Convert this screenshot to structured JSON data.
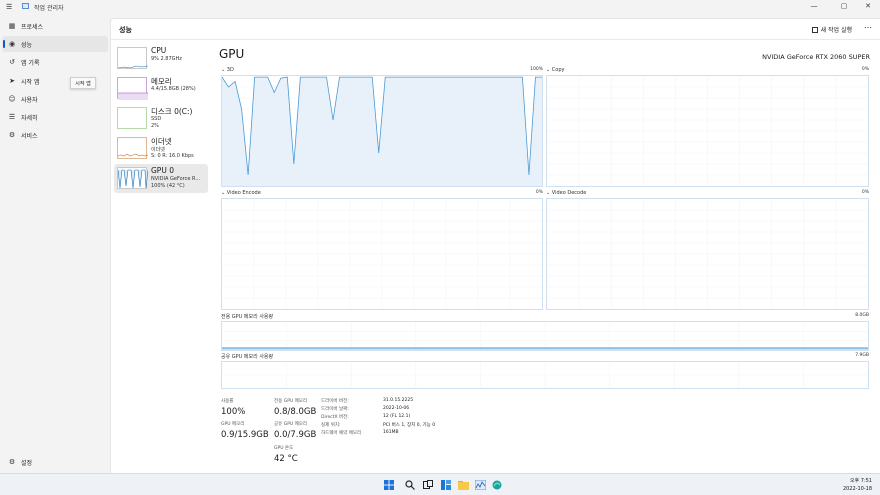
{
  "window": {
    "title": "작업 관리자",
    "minimize": "—",
    "maximize": "▢",
    "close": "✕"
  },
  "nav": {
    "items": [
      {
        "icon": "▦",
        "label": "프로세스"
      },
      {
        "icon": "◉",
        "label": "성능"
      },
      {
        "icon": "↺",
        "label": "앱 기록"
      },
      {
        "icon": "➤",
        "label": "시작 앱"
      },
      {
        "icon": "☺",
        "label": "사용자"
      },
      {
        "icon": "☰",
        "label": "자세히"
      },
      {
        "icon": "⚙",
        "label": "서비스"
      }
    ],
    "settings": {
      "icon": "⚙",
      "label": "설정"
    },
    "tooltip": "시작 앱"
  },
  "header": {
    "title": "성능",
    "run_task": "새 작업 실행",
    "more": "⋯"
  },
  "resources": [
    {
      "name": "CPU",
      "sub1": "9% 2.87GHz",
      "sub2": ""
    },
    {
      "name": "메모리",
      "sub1": "4.4/15.8GB (28%)",
      "sub2": ""
    },
    {
      "name": "디스크 0(C:)",
      "sub1": "SSD",
      "sub2": "2%"
    },
    {
      "name": "이더넷",
      "sub1": "이더넷",
      "sub2": "S: 0 R: 16.0 Kbps"
    },
    {
      "name": "GPU 0",
      "sub1": "NVIDIA GeForce R...",
      "sub2": "100% (42 °C)"
    }
  ],
  "gpu": {
    "title": "GPU",
    "model": "NVIDIA GeForce RTX 2060 SUPER",
    "engines": [
      {
        "label": "3D",
        "pct": "100%"
      },
      {
        "label": "Copy",
        "pct": "0%"
      },
      {
        "label": "Video Encode",
        "pct": "0%"
      },
      {
        "label": "Video Decode",
        "pct": "0%"
      }
    ],
    "dedicated_graph": {
      "label": "전용 GPU 메모리 사용량",
      "max": "8.0GB"
    },
    "shared_graph": {
      "label": "공유 GPU 메모리 사용량",
      "max": "7.9GB"
    },
    "utilization_3d": [
      0.99,
      0.9,
      0.95,
      0.7,
      0.1,
      0.99,
      0.99,
      0.99,
      0.85,
      0.98,
      0.99,
      0.2,
      0.99,
      0.99,
      0.99,
      0.99,
      0.99,
      0.6,
      0.99,
      0.99,
      0.99,
      0.99,
      0.99,
      0.99,
      0.3,
      0.99,
      0.99,
      0.99,
      0.99,
      0.99,
      0.99,
      0.99,
      0.99,
      0.99,
      0.99,
      0.99,
      0.99,
      0.99,
      0.99,
      0.99,
      0.99,
      0.99,
      0.99,
      0.99,
      0.99,
      0.99,
      0.99,
      0.1,
      0.99,
      0.99
    ],
    "stats": [
      {
        "label": "사용률",
        "value": "100%"
      },
      {
        "label": "GPU 메모리",
        "value": "0.9/15.9GB"
      },
      {
        "label": "전용 GPU 메모리",
        "value": "0.8/8.0GB"
      },
      {
        "label": "공유 GPU 메모리",
        "value": "0.0/7.9GB"
      },
      {
        "label": "GPU 온도",
        "value": "42 °C"
      }
    ],
    "info": [
      {
        "label": "드라이버 버전:",
        "value": "31.0.15.2225"
      },
      {
        "label": "드라이버 날짜:",
        "value": "2022-10-06"
      },
      {
        "label": "DirectX 버전:",
        "value": "12 (FL 12.1)"
      },
      {
        "label": "실제 위치:",
        "value": "PCI 버스 1, 장치 0, 기능 0"
      },
      {
        "label": "하드웨어 예약 메모리",
        "value": "161MB"
      }
    ]
  },
  "taskbar": {
    "time": "오후 7:51",
    "date": "2022-10-18",
    "icons": [
      "windows-start-icon",
      "search-icon",
      "task-view-icon",
      "widgets-icon",
      "file-explorer-icon",
      "store-icon",
      "task-manager-icon",
      "edge-icon"
    ]
  },
  "colors": {
    "accent": "#1a73b8",
    "graph_fill": "#e8f1fa",
    "graph_line": "#4a9ad4"
  }
}
